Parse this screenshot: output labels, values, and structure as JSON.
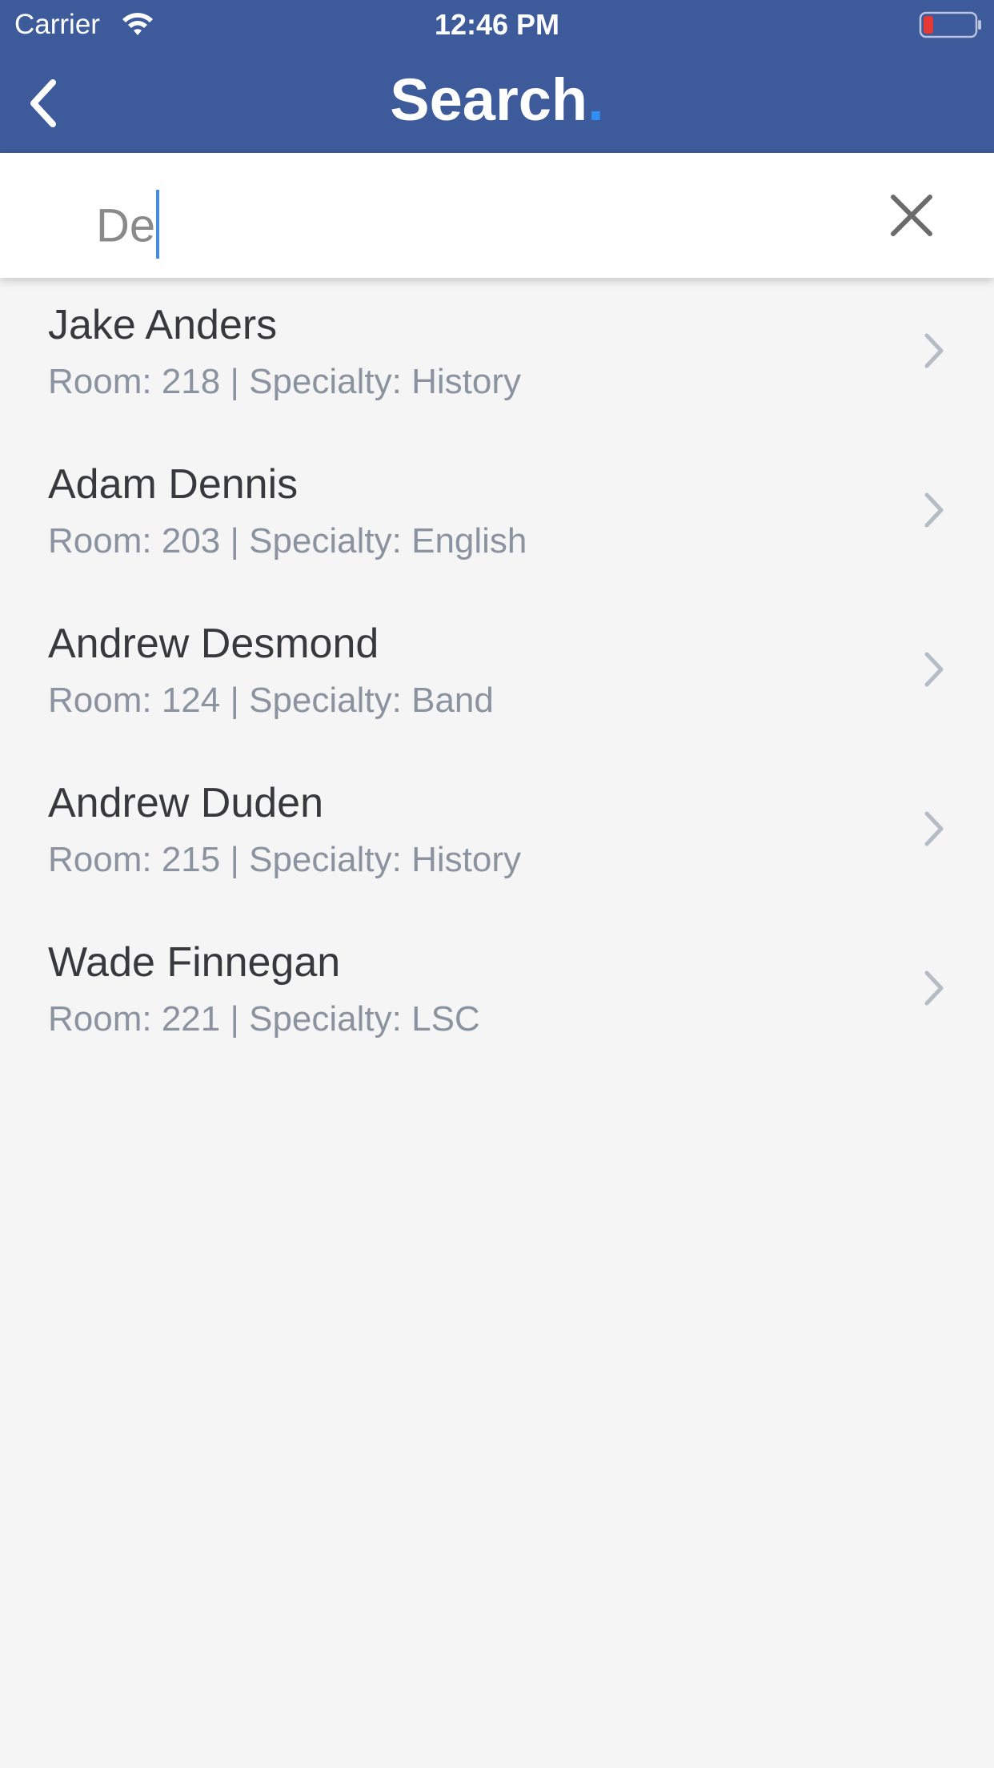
{
  "status_bar": {
    "carrier": "Carrier",
    "time": "12:46 PM",
    "wifi_icon": "wifi-icon",
    "battery_icon": "battery-low-icon",
    "battery_color": "#e53935"
  },
  "header": {
    "title": "Search",
    "title_dot": ".",
    "back_icon": "chevron-left-icon",
    "background_color": "#3d5a9a",
    "dot_color": "#2f8ff5"
  },
  "search": {
    "value": "De",
    "clear_icon": "close-icon",
    "caret_color": "#3f8de8"
  },
  "results": [
    {
      "name": "Jake Anders",
      "details": "Room: 218 | Specialty: History"
    },
    {
      "name": "Adam Dennis",
      "details": "Room: 203 | Specialty: English"
    },
    {
      "name": "Andrew Desmond",
      "details": "Room: 124 | Specialty: Band"
    },
    {
      "name": "Andrew Duden",
      "details": "Room: 215 | Specialty: History"
    },
    {
      "name": "Wade Finnegan",
      "details": "Room: 221 | Specialty: LSC"
    }
  ]
}
